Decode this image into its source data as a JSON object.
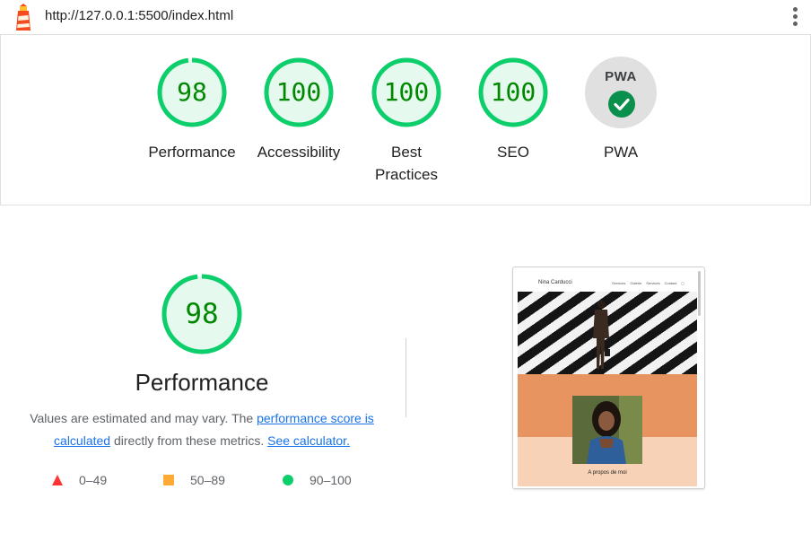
{
  "topbar": {
    "url": "http://127.0.0.1:5500/index.html",
    "logo_icon": "lighthouse-icon",
    "menu_icon": "more-vert-icon"
  },
  "categories": [
    {
      "id": "performance",
      "score": "98",
      "label": "Performance"
    },
    {
      "id": "accessibility",
      "score": "100",
      "label": "Accessibility"
    },
    {
      "id": "best-practices",
      "score": "100",
      "label": "Best Practices"
    },
    {
      "id": "seo",
      "score": "100",
      "label": "SEO"
    }
  ],
  "pwa": {
    "badge": "PWA",
    "label": "PWA",
    "icon": "check-icon"
  },
  "performance": {
    "score": "98",
    "title": "Performance",
    "desc_prefix": "Values are estimated and may vary. The ",
    "desc_link1": "performance score is calculated",
    "desc_middle": " directly from these metrics. ",
    "desc_link2": "See calculator."
  },
  "legend": [
    {
      "range": "0–49",
      "shape": "triangle",
      "color": "#ff3333"
    },
    {
      "range": "50–89",
      "shape": "square",
      "color": "#ffaa33"
    },
    {
      "range": "90–100",
      "shape": "circle",
      "color": "#0cce6b"
    }
  ],
  "thumbnail": {
    "site_name": "Nina Carducci",
    "nav": [
      "Services",
      "Galerie",
      "Services",
      "Contact"
    ],
    "section_title": "A propos de moi"
  },
  "colors": {
    "pass_green": "#0cce6b",
    "pass_text": "#008800",
    "pass_fill": "#e5f9ee",
    "link": "#1a73e8"
  }
}
